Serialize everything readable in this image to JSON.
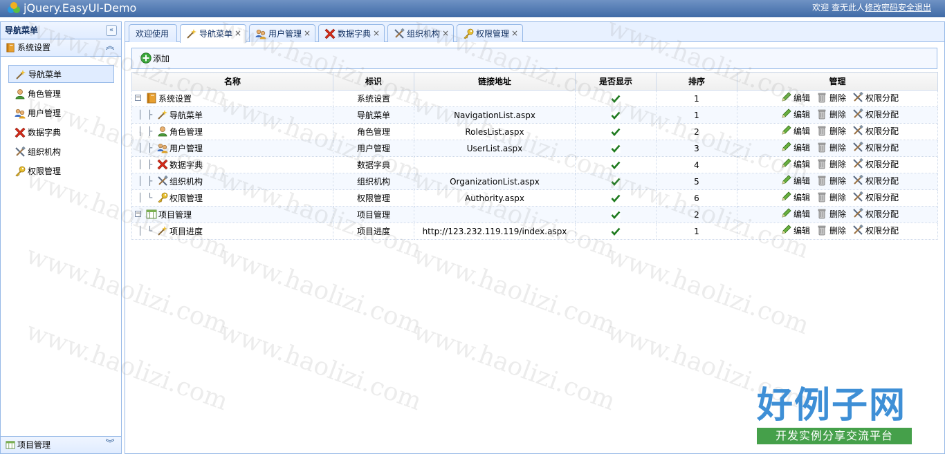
{
  "header": {
    "title": "jQuery.EasyUI-Demo",
    "welcome": "欢迎 查无此人",
    "change_password": "修改密码",
    "logout": "安全退出"
  },
  "west": {
    "title": "导航菜单",
    "collapse_icon": "double-chevron-left-icon",
    "accordion": [
      {
        "label": "系统设置",
        "icon": "book-icon",
        "expanded": true,
        "items": [
          {
            "label": "导航菜单",
            "icon": "wand-icon",
            "selected": true
          },
          {
            "label": "角色管理",
            "icon": "user-icon"
          },
          {
            "label": "用户管理",
            "icon": "users-icon"
          },
          {
            "label": "数据字典",
            "icon": "red-x-icon"
          },
          {
            "label": "组织机构",
            "icon": "tools-icon"
          },
          {
            "label": "权限管理",
            "icon": "key-icon"
          }
        ]
      },
      {
        "label": "项目管理",
        "icon": "calendar-icon",
        "expanded": false
      }
    ]
  },
  "tabs": [
    {
      "label": "欢迎使用",
      "closable": false
    },
    {
      "label": "导航菜单",
      "icon": "wand-icon",
      "closable": true,
      "active": true
    },
    {
      "label": "用户管理",
      "icon": "users-icon",
      "closable": true
    },
    {
      "label": "数据字典",
      "icon": "red-x-icon",
      "closable": true
    },
    {
      "label": "组织机构",
      "icon": "tools-icon",
      "closable": true
    },
    {
      "label": "权限管理",
      "icon": "key-icon",
      "closable": true
    }
  ],
  "toolbar": {
    "add_label": "添加"
  },
  "grid": {
    "columns": [
      "名称",
      "标识",
      "链接地址",
      "是否显示",
      "排序",
      "管理"
    ],
    "actions": {
      "edit": "编辑",
      "delete": "删除",
      "permission": "权限分配"
    },
    "close_glyph": "×",
    "rows": [
      {
        "name": "系统设置",
        "code": "系统设置",
        "url": "",
        "order": "1",
        "level": 0,
        "icon": "book-icon",
        "toggle": true
      },
      {
        "name": "导航菜单",
        "code": "导航菜单",
        "url": "NavigationList.aspx",
        "order": "1",
        "level": 1,
        "icon": "wand-icon"
      },
      {
        "name": "角色管理",
        "code": "角色管理",
        "url": "RolesList.aspx",
        "order": "2",
        "level": 1,
        "icon": "user-icon"
      },
      {
        "name": "用户管理",
        "code": "用户管理",
        "url": "UserList.aspx",
        "order": "3",
        "level": 1,
        "icon": "users-icon"
      },
      {
        "name": "数据字典",
        "code": "数据字典",
        "url": "",
        "order": "4",
        "level": 1,
        "icon": "red-x-icon"
      },
      {
        "name": "组织机构",
        "code": "组织机构",
        "url": "OrganizationList.aspx",
        "order": "5",
        "level": 1,
        "icon": "tools-icon"
      },
      {
        "name": "权限管理",
        "code": "权限管理",
        "url": "Authority.aspx",
        "order": "6",
        "level": 1,
        "icon": "key-icon",
        "last": true
      },
      {
        "name": "项目管理",
        "code": "项目管理",
        "url": "",
        "order": "2",
        "level": 0,
        "icon": "calendar-icon",
        "toggle": true
      },
      {
        "name": "项目进度",
        "code": "项目进度",
        "url": "http://123.232.119.119/index.aspx",
        "order": "1",
        "level": 1,
        "icon": "wand-icon",
        "last": true
      }
    ]
  },
  "watermark": {
    "text": "www.haolizi.com",
    "brand_main": "好例子网",
    "brand_sub": "开发实例分享交流平台"
  },
  "colors": {
    "header": "#4a74ae",
    "border": "#95b8e7",
    "panel": "#e0ecff",
    "brand_blue": "#3e8fd6",
    "brand_green": "#45a04a"
  }
}
